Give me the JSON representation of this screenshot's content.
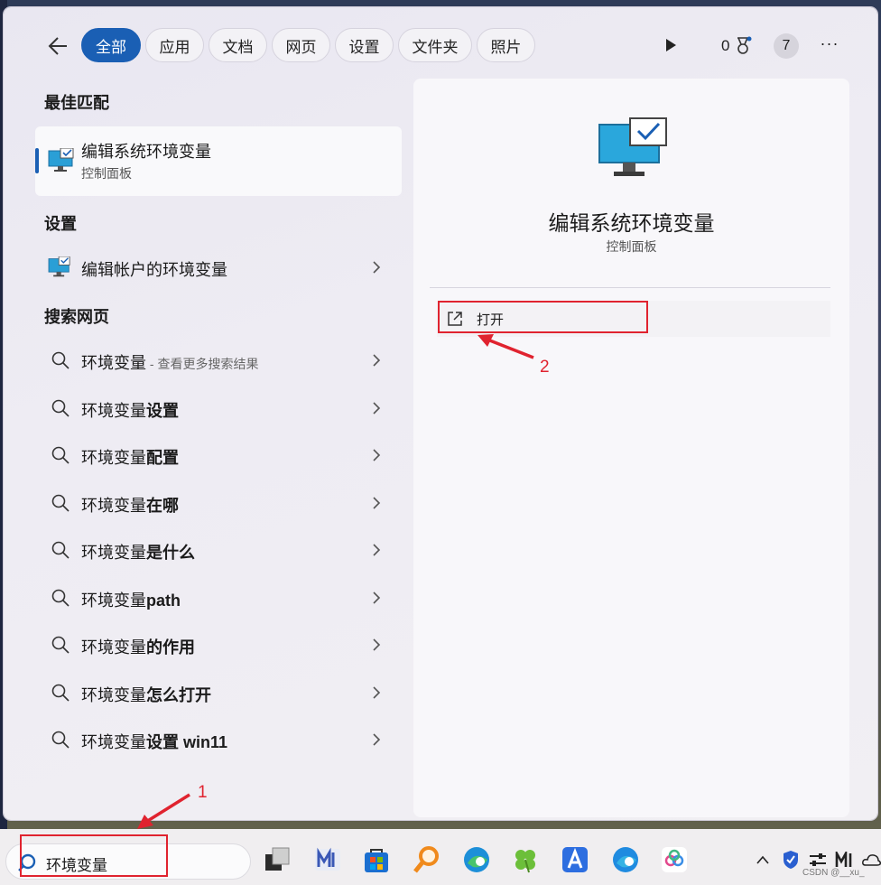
{
  "tabs": [
    "全部",
    "应用",
    "文档",
    "网页",
    "设置",
    "文件夹",
    "照片"
  ],
  "topbar": {
    "points": "0",
    "badge": "7",
    "more": "···"
  },
  "best_match": {
    "heading": "最佳匹配",
    "title": "编辑系统环境变量",
    "subtitle": "控制面板"
  },
  "settings": {
    "heading": "设置",
    "item": "编辑帐户的环境变量"
  },
  "web": {
    "heading": "搜索网页",
    "items": [
      {
        "prefix": "环境变量",
        "bold": "",
        "hint": " - 查看更多搜索结果"
      },
      {
        "prefix": "环境变量",
        "bold": "设置",
        "hint": ""
      },
      {
        "prefix": "环境变量",
        "bold": "配置",
        "hint": ""
      },
      {
        "prefix": "环境变量",
        "bold": "在哪",
        "hint": ""
      },
      {
        "prefix": "环境变量",
        "bold": "是什么",
        "hint": ""
      },
      {
        "prefix": "环境变量",
        "bold": "path",
        "hint": ""
      },
      {
        "prefix": "环境变量",
        "bold": "的作用",
        "hint": ""
      },
      {
        "prefix": "环境变量",
        "bold": "怎么打开",
        "hint": ""
      },
      {
        "prefix": "环境变量",
        "bold": "设置 win11",
        "hint": ""
      }
    ]
  },
  "detail": {
    "title": "编辑系统环境变量",
    "subtitle": "控制面板",
    "open_label": "打开"
  },
  "annotations": {
    "one": "1",
    "two": "2"
  },
  "taskbar": {
    "search_value": "环境变量"
  },
  "watermark": "CSDN @__xu_",
  "colors": {
    "accent": "#1a5fb4",
    "annotation": "#e0232f"
  }
}
